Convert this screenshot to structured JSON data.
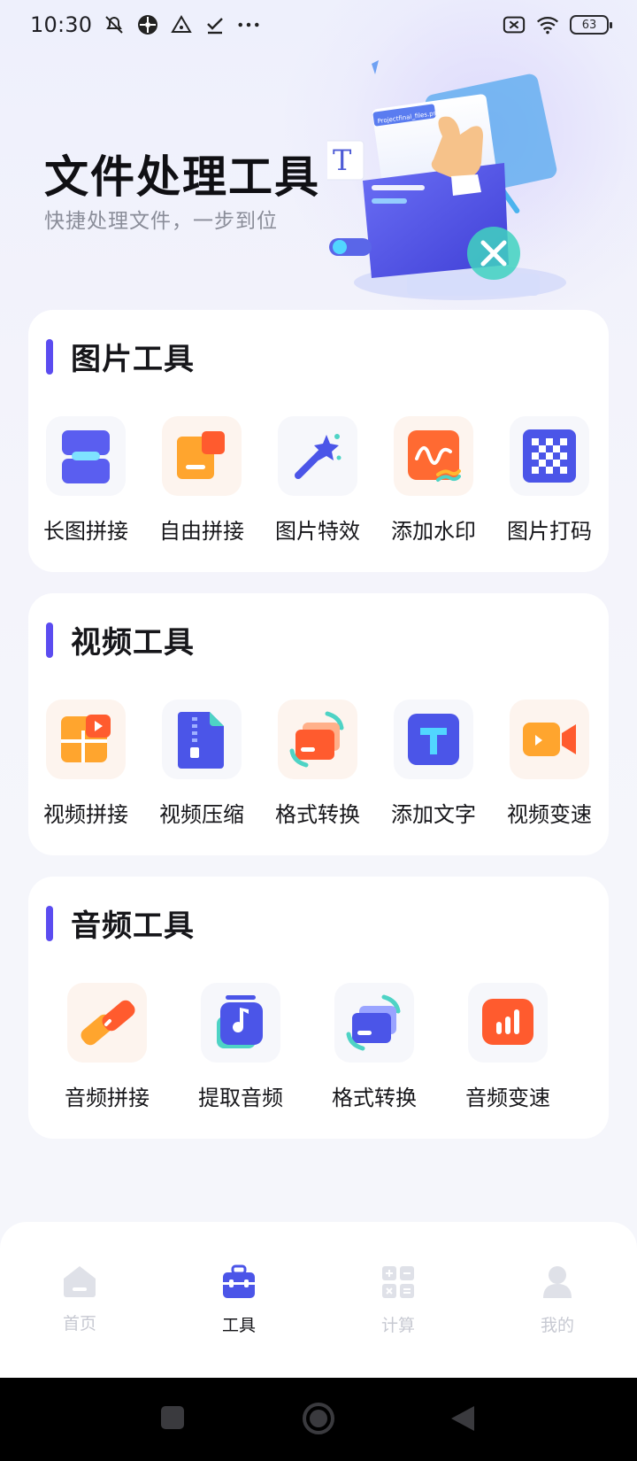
{
  "status_bar": {
    "time": "10:30",
    "battery": "63",
    "icons": [
      "mute-icon",
      "pinwheel-icon",
      "triangle-alert-icon",
      "check-icon",
      "more-dots-icon",
      "sim-off-icon",
      "wifi-icon",
      "battery-icon"
    ]
  },
  "hero": {
    "title": "文件处理工具",
    "subtitle": "快捷处理文件，一步到位",
    "doc_label": "Projectfinal_files.psd"
  },
  "sections": [
    {
      "title": "图片工具",
      "tools": [
        {
          "label": "长图拼接",
          "icon": "long-image-stitch-icon"
        },
        {
          "label": "自由拼接",
          "icon": "free-stitch-icon"
        },
        {
          "label": "图片特效",
          "icon": "magic-wand-icon"
        },
        {
          "label": "添加水印",
          "icon": "watermark-icon"
        },
        {
          "label": "图片打码",
          "icon": "mosaic-icon"
        }
      ]
    },
    {
      "title": "视频工具",
      "tools": [
        {
          "label": "视频拼接",
          "icon": "video-stitch-icon"
        },
        {
          "label": "视频压缩",
          "icon": "zip-file-icon"
        },
        {
          "label": "格式转换",
          "icon": "format-convert-icon"
        },
        {
          "label": "添加文字",
          "icon": "text-t-icon"
        },
        {
          "label": "视频变速",
          "icon": "video-camera-icon"
        }
      ]
    },
    {
      "title": "音频工具",
      "tools": [
        {
          "label": "音频拼接",
          "icon": "audio-link-icon"
        },
        {
          "label": "提取音频",
          "icon": "music-note-icon"
        },
        {
          "label": "格式转换",
          "icon": "format-convert-icon"
        },
        {
          "label": "音频变速",
          "icon": "bar-chart-icon"
        }
      ]
    }
  ],
  "bottom_nav": [
    {
      "label": "首页",
      "icon": "home-icon",
      "active": false
    },
    {
      "label": "工具",
      "icon": "toolbox-icon",
      "active": true
    },
    {
      "label": "计算",
      "icon": "calculator-icon",
      "active": false
    },
    {
      "label": "我的",
      "icon": "user-icon",
      "active": false
    }
  ],
  "colors": {
    "accent": "#5b4cf0",
    "blue": "#4b55e8",
    "orange": "#ff9f2b",
    "red_orange": "#ff5b2e",
    "inactive": "#c7c9d2"
  }
}
